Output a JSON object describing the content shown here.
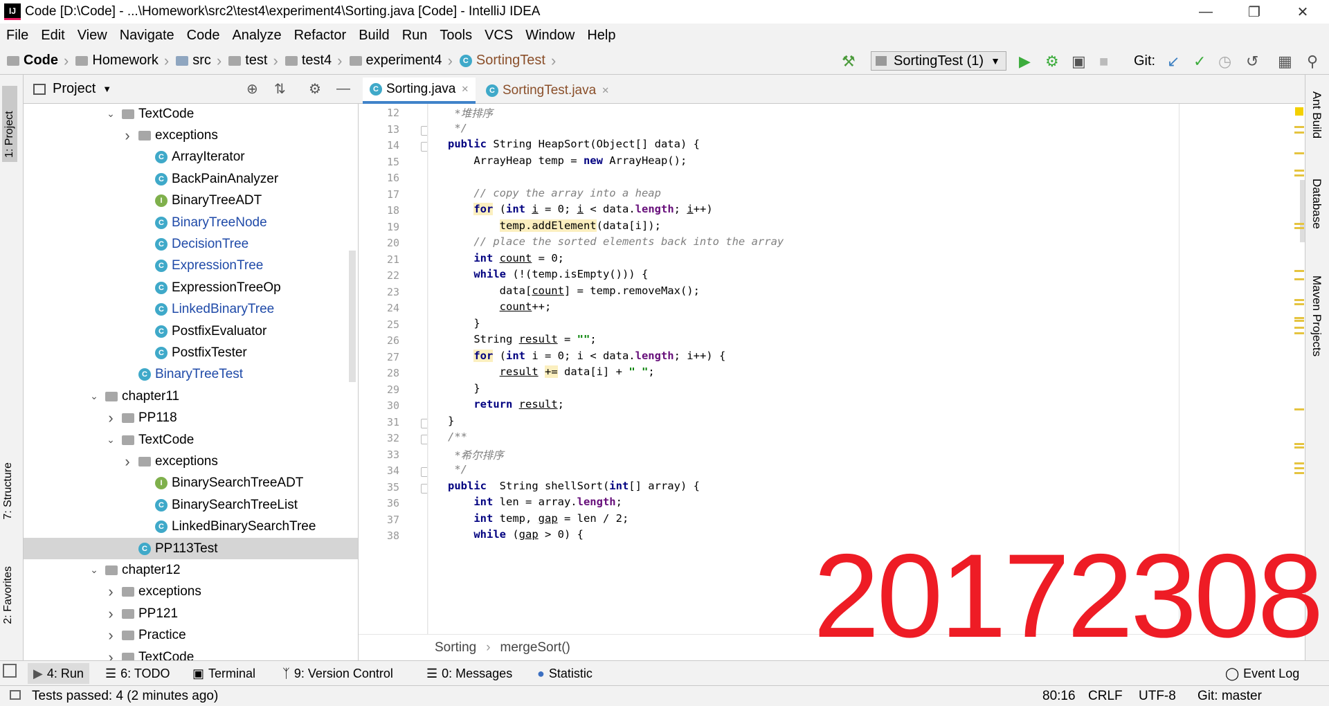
{
  "window": {
    "title": "Code [D:\\Code] - ...\\Homework\\src2\\test4\\experiment4\\Sorting.java [Code] - IntelliJ IDEA"
  },
  "menu": [
    "File",
    "Edit",
    "View",
    "Navigate",
    "Code",
    "Analyze",
    "Refactor",
    "Build",
    "Run",
    "Tools",
    "VCS",
    "Window",
    "Help"
  ],
  "breadcrumb": [
    "Code",
    "Homework",
    "src",
    "test",
    "test4",
    "experiment4",
    "SortingTest"
  ],
  "toolbar": {
    "run_config": "SortingTest (1)",
    "git_label": "Git:"
  },
  "project_panel": {
    "title": "Project",
    "tree": [
      {
        "label": "TextCode",
        "kind": "folder",
        "expand": "open",
        "indent": 1
      },
      {
        "label": "exceptions",
        "kind": "folder",
        "expand": "closed",
        "indent": 2
      },
      {
        "label": "ArrayIterator",
        "kind": "class",
        "indent": 3
      },
      {
        "label": "BackPainAnalyzer",
        "kind": "class-run",
        "indent": 3
      },
      {
        "label": "BinaryTreeADT",
        "kind": "interface",
        "indent": 3
      },
      {
        "label": "BinaryTreeNode",
        "kind": "class",
        "indent": 3,
        "modified": true
      },
      {
        "label": "DecisionTree",
        "kind": "class",
        "indent": 3,
        "modified": true
      },
      {
        "label": "ExpressionTree",
        "kind": "class",
        "indent": 3,
        "modified": true
      },
      {
        "label": "ExpressionTreeOp",
        "kind": "class",
        "indent": 3
      },
      {
        "label": "LinkedBinaryTree",
        "kind": "class",
        "indent": 3,
        "modified": true
      },
      {
        "label": "PostfixEvaluator",
        "kind": "class",
        "indent": 3
      },
      {
        "label": "PostfixTester",
        "kind": "class-run",
        "indent": 3
      },
      {
        "label": "BinaryTreeTest",
        "kind": "class-run",
        "indent": 2,
        "modified": true
      },
      {
        "label": "chapter11",
        "kind": "folder",
        "expand": "open",
        "indent": 0
      },
      {
        "label": "PP118",
        "kind": "folder",
        "expand": "closed",
        "indent": 1
      },
      {
        "label": "TextCode",
        "kind": "folder",
        "expand": "open",
        "indent": 1
      },
      {
        "label": "exceptions",
        "kind": "folder",
        "expand": "closed",
        "indent": 2
      },
      {
        "label": "BinarySearchTreeADT",
        "kind": "interface",
        "indent": 3
      },
      {
        "label": "BinarySearchTreeList",
        "kind": "class",
        "indent": 3
      },
      {
        "label": "LinkedBinarySearchTree",
        "kind": "class",
        "indent": 3
      },
      {
        "label": "PP113Test",
        "kind": "class-run",
        "indent": 2,
        "selected": true
      },
      {
        "label": "chapter12",
        "kind": "folder",
        "expand": "open",
        "indent": 0
      },
      {
        "label": "exceptions",
        "kind": "folder",
        "expand": "closed",
        "indent": 1
      },
      {
        "label": "PP121",
        "kind": "folder",
        "expand": "closed",
        "indent": 1
      },
      {
        "label": "Practice",
        "kind": "folder",
        "expand": "closed",
        "indent": 1
      },
      {
        "label": "TextCode",
        "kind": "folder",
        "expand": "closed",
        "indent": 1
      }
    ]
  },
  "editor": {
    "tabs": [
      {
        "label": "Sorting.java",
        "active": true
      },
      {
        "label": "SortingTest.java",
        "active": false
      }
    ],
    "first_line": 12,
    "lines": [
      [
        [
          "cm",
          "    *堆排序"
        ]
      ],
      [
        [
          "cm",
          "    */"
        ]
      ],
      [
        [
          "kw",
          "   public "
        ],
        [
          "",
          "String HeapSort(Object[] data) {"
        ]
      ],
      [
        [
          "",
          "       ArrayHeap temp = "
        ],
        [
          "kw",
          "new "
        ],
        [
          "",
          "ArrayHeap();"
        ]
      ],
      [
        [
          "",
          ""
        ]
      ],
      [
        [
          "cm",
          "       // copy the array into a heap"
        ]
      ],
      [
        [
          "",
          "       "
        ],
        [
          "kw hl",
          "for"
        ],
        [
          "",
          " ("
        ],
        [
          "kw",
          "int "
        ],
        [
          "ul",
          "i"
        ],
        [
          "",
          " = 0; "
        ],
        [
          "ul",
          "i"
        ],
        [
          "",
          " < data."
        ],
        [
          "fld",
          "length"
        ],
        [
          "",
          "; "
        ],
        [
          "ul",
          "i"
        ],
        [
          "",
          "++)"
        ]
      ],
      [
        [
          "",
          "           "
        ],
        [
          "hl",
          "temp.addElement"
        ],
        [
          "",
          "(data[i]);"
        ]
      ],
      [
        [
          "cm",
          "       // place the sorted elements back into the array"
        ]
      ],
      [
        [
          "kw",
          "       int "
        ],
        [
          "ul",
          "count"
        ],
        [
          "",
          " = 0;"
        ]
      ],
      [
        [
          "kw",
          "       while "
        ],
        [
          "",
          "(!(temp.isEmpty())) {"
        ]
      ],
      [
        [
          "",
          "           data["
        ],
        [
          "ul",
          "count"
        ],
        [
          "",
          "] = temp.removeMax();"
        ]
      ],
      [
        [
          "",
          "           "
        ],
        [
          "ul",
          "count"
        ],
        [
          "",
          "++;"
        ]
      ],
      [
        [
          "",
          "       }"
        ]
      ],
      [
        [
          "",
          "       String "
        ],
        [
          "ul",
          "result"
        ],
        [
          "",
          " = "
        ],
        [
          "st",
          "\"\""
        ],
        [
          "",
          ";"
        ]
      ],
      [
        [
          "",
          "       "
        ],
        [
          "kw hl",
          "for"
        ],
        [
          "",
          " ("
        ],
        [
          "kw",
          "int "
        ],
        [
          "",
          "i = 0; i < data."
        ],
        [
          "fld",
          "length"
        ],
        [
          "",
          "; i++) {"
        ]
      ],
      [
        [
          "",
          "           "
        ],
        [
          "ul",
          "result"
        ],
        [
          "",
          " "
        ],
        [
          "hl",
          "+="
        ],
        [
          "",
          " data[i] + "
        ],
        [
          "st",
          "\" \""
        ],
        [
          "",
          ";"
        ]
      ],
      [
        [
          "",
          "       }"
        ]
      ],
      [
        [
          "kw",
          "       return "
        ],
        [
          "ul",
          "result"
        ],
        [
          "",
          ";"
        ]
      ],
      [
        [
          "",
          "   }"
        ]
      ],
      [
        [
          "cm",
          "   /**"
        ]
      ],
      [
        [
          "cm",
          "    *希尔排序"
        ]
      ],
      [
        [
          "cm",
          "    */"
        ]
      ],
      [
        [
          "kw",
          "   public  "
        ],
        [
          "",
          "String shellSort("
        ],
        [
          "kw",
          "int"
        ],
        [
          "",
          "[] array) {"
        ]
      ],
      [
        [
          "kw",
          "       int "
        ],
        [
          "",
          "len = array."
        ],
        [
          "fld",
          "length"
        ],
        [
          "",
          ";"
        ]
      ],
      [
        [
          "kw",
          "       int "
        ],
        [
          "",
          "temp, "
        ],
        [
          "ul",
          "gap"
        ],
        [
          "",
          " = len / 2;"
        ]
      ],
      [
        [
          "kw",
          "       while "
        ],
        [
          "",
          "("
        ],
        [
          "ul",
          "gap"
        ],
        [
          "",
          " > 0) {"
        ]
      ]
    ],
    "breadcrumb": [
      "Sorting",
      "mergeSort()"
    ]
  },
  "watermark": "20172308",
  "right_tabs": [
    "Ant Build",
    "Database",
    "Maven Projects"
  ],
  "left_tabs": [
    "1: Project",
    "7: Structure",
    "2: Favorites"
  ],
  "tool_windows": [
    "4: Run",
    "6: TODO",
    "Terminal",
    "9: Version Control",
    "0: Messages",
    "Statistic",
    "Event Log"
  ],
  "status": {
    "message": "Tests passed: 4 (2 minutes ago)",
    "position": "80:16",
    "line_sep": "CRLF",
    "encoding": "UTF-8",
    "git": "Git: master"
  },
  "colors": {
    "keyword": "#000080",
    "comment": "#808080",
    "string": "#008000",
    "field": "#660e7a",
    "modified": "#1f4aa8",
    "watermark": "#ee1c25"
  }
}
